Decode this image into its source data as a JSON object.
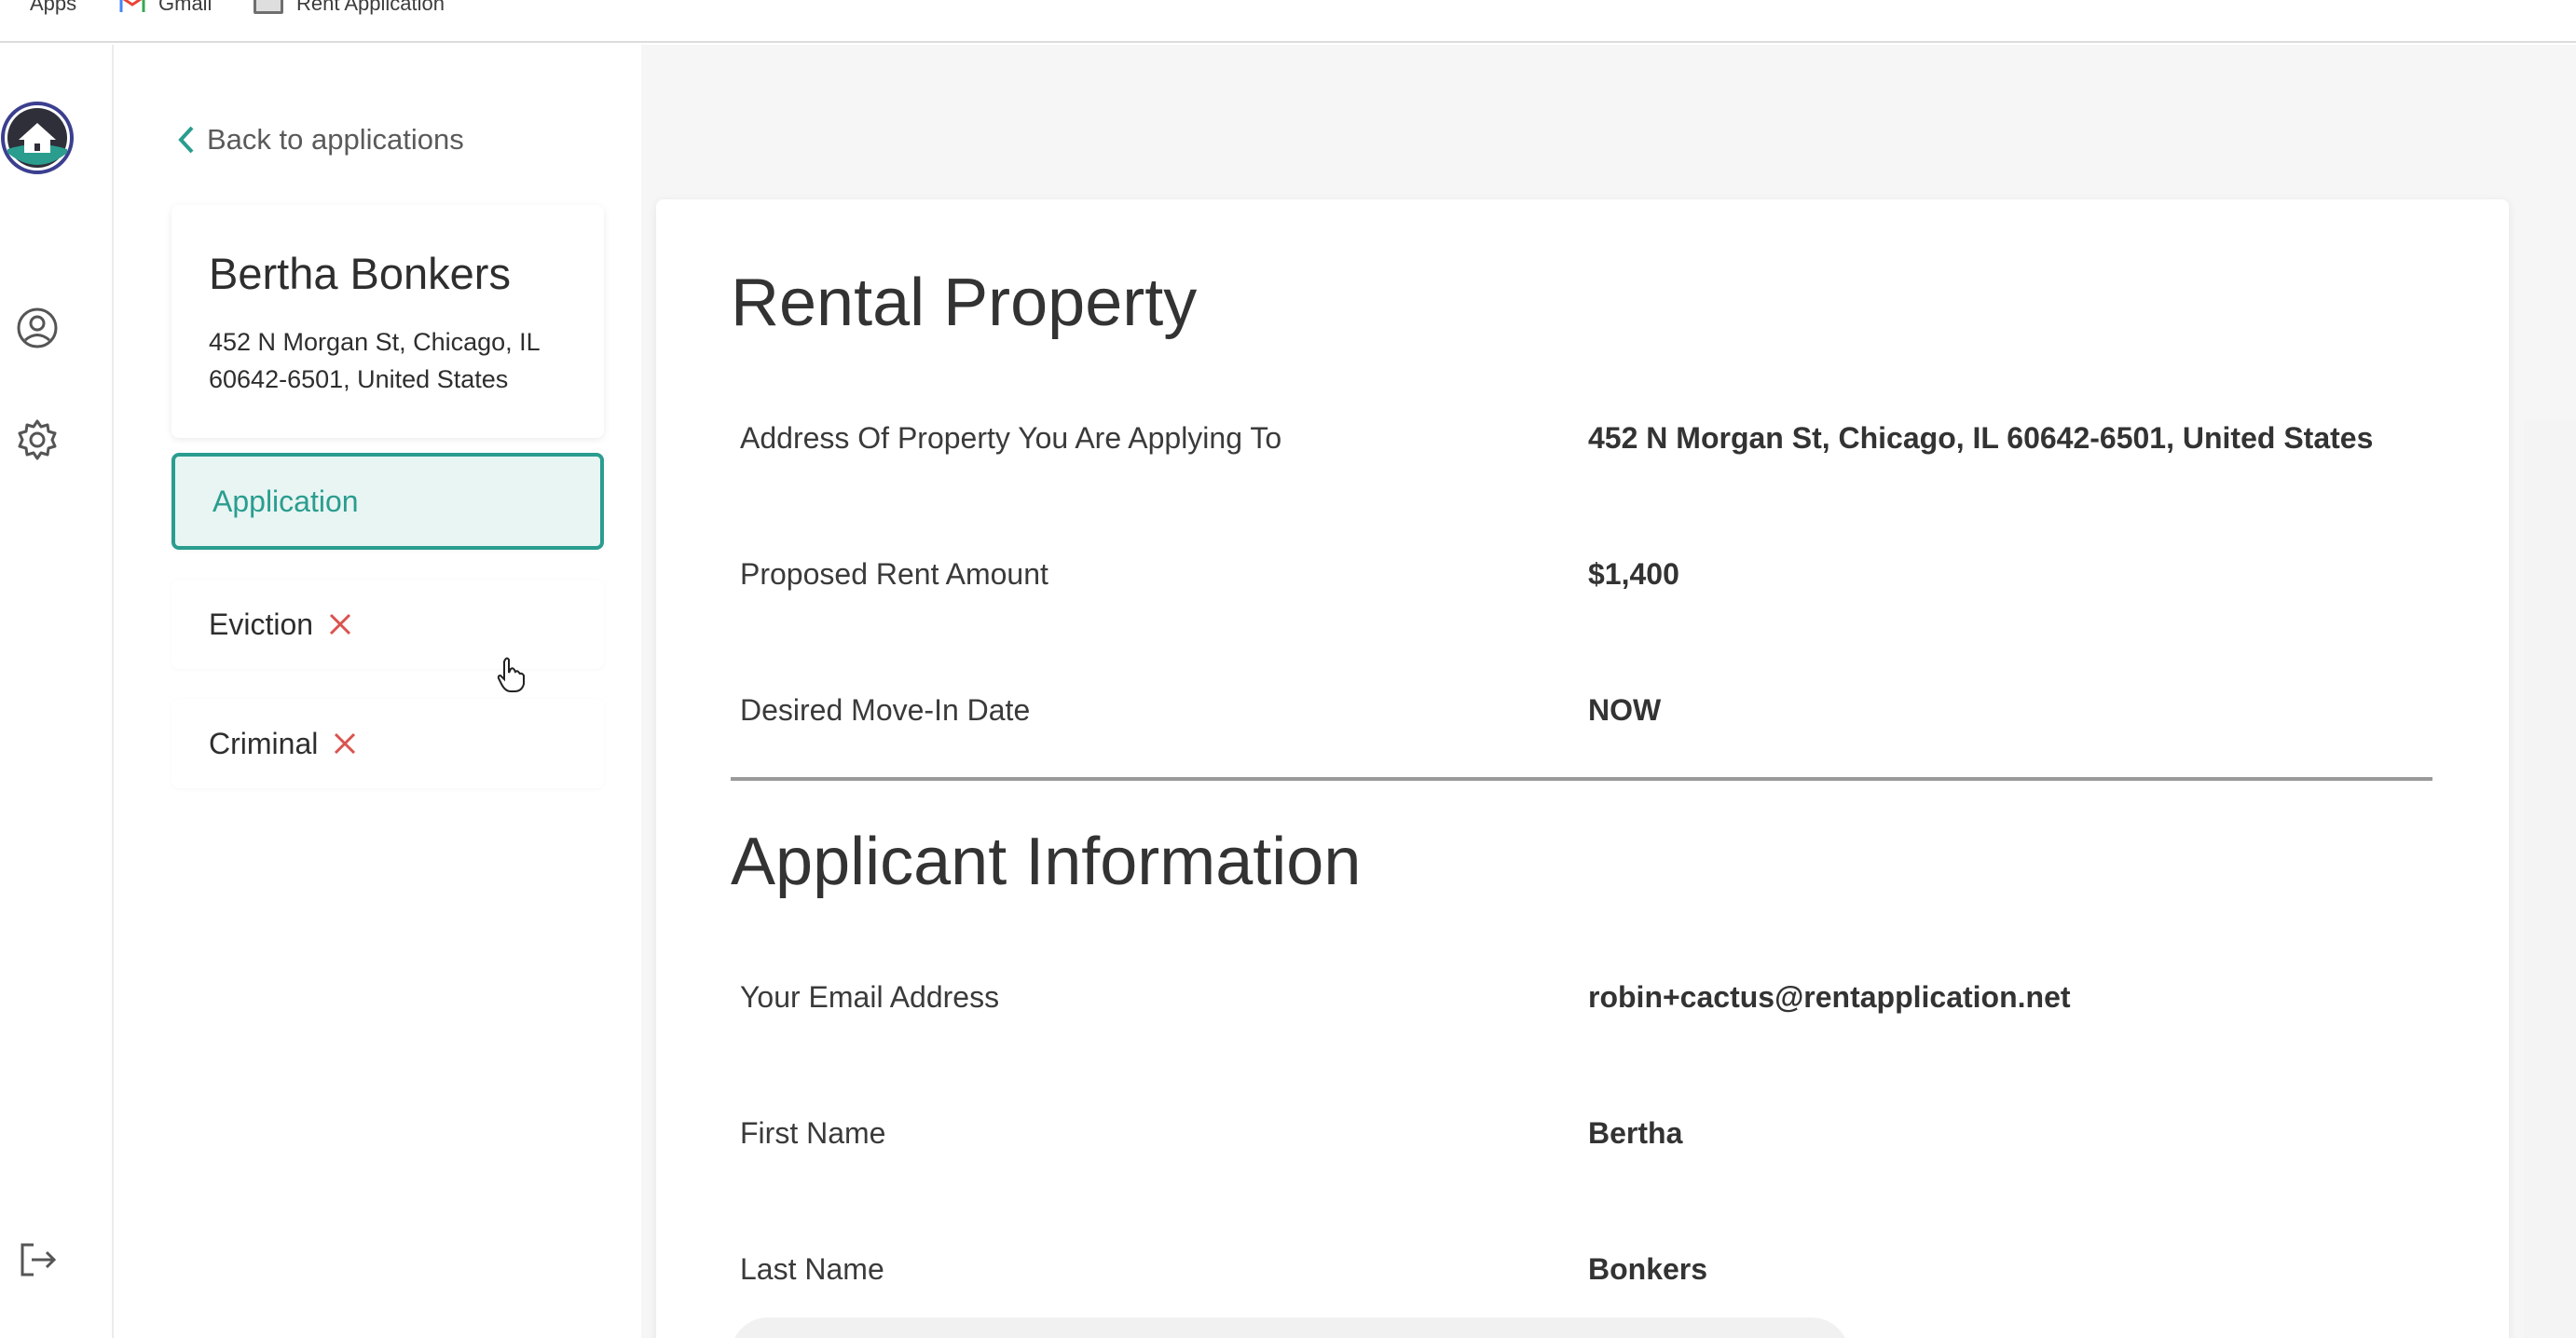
{
  "bookmarks": {
    "apps": "Apps",
    "gmail": "Gmail",
    "rent_application": "Rent Application"
  },
  "back_link": "Back to applications",
  "applicant": {
    "name": "Bertha Bonkers",
    "address_line1": "452 N Morgan St, Chicago, IL",
    "address_line2": "60642-6501, United States"
  },
  "nav": {
    "application": "Application",
    "eviction": "Eviction",
    "criminal": "Criminal"
  },
  "colors": {
    "accent": "#2a9d8f",
    "danger": "#d9534f"
  },
  "rental_property": {
    "title": "Rental Property",
    "rows": [
      {
        "label": "Address Of Property You Are Applying To",
        "value": "452 N Morgan St, Chicago, IL 60642-6501, United States"
      },
      {
        "label": "Proposed Rent Amount",
        "value": "$1,400"
      },
      {
        "label": "Desired Move-In Date",
        "value": "NOW"
      }
    ]
  },
  "applicant_information": {
    "title": "Applicant Information",
    "rows": [
      {
        "label": "Your Email Address",
        "value": "robin+cactus@rentapplication.net"
      },
      {
        "label": "First Name",
        "value": "Bertha"
      },
      {
        "label": "Last Name",
        "value": "Bonkers"
      }
    ]
  }
}
